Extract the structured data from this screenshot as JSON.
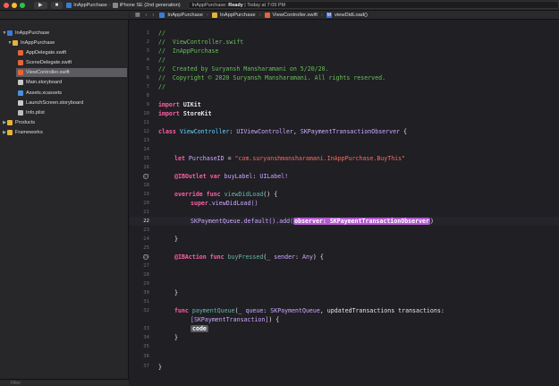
{
  "toolbar": {
    "run_glyph": "▶",
    "stop_glyph": "■",
    "scheme_name": "InAppPurchase",
    "device_name": "iPhone SE (2nd generation)",
    "status_app": "InAppPurchase:",
    "status_state": "Ready",
    "status_time": "Today at 7:09 PM"
  },
  "navigator": {
    "items": [
      {
        "label": "InAppPurchase",
        "icon": "project-icon"
      },
      {
        "label": "InAppPurchase",
        "icon": "folder-icon"
      },
      {
        "label": "AppDelegate.swift",
        "icon": "swift-file-icon"
      },
      {
        "label": "SceneDelegate.swift",
        "icon": "swift-file-icon"
      },
      {
        "label": "ViewController.swift",
        "icon": "swift-file-icon"
      },
      {
        "label": "Main.storyboard",
        "icon": "storyboard-icon"
      },
      {
        "label": "Assets.xcassets",
        "icon": "assets-icon"
      },
      {
        "label": "LaunchScreen.storyboard",
        "icon": "storyboard-icon"
      },
      {
        "label": "Info.plist",
        "icon": "plist-icon"
      },
      {
        "label": "Products",
        "icon": "folder-icon"
      },
      {
        "label": "Frameworks",
        "icon": "folder-icon"
      }
    ],
    "filter_placeholder": "Filter"
  },
  "jumpbar": {
    "crumbs": [
      "InAppPurchase",
      "InAppPurchase",
      "ViewController.swift",
      "viewDidLoad()"
    ],
    "method_badge": "M"
  },
  "editor": {
    "current_line": 22,
    "lines": [
      {
        "n": "1"
      },
      {
        "n": "2"
      },
      {
        "n": "3"
      },
      {
        "n": "4"
      },
      {
        "n": "5"
      },
      {
        "n": "6"
      },
      {
        "n": "7"
      },
      {
        "n": "8"
      },
      {
        "n": "9"
      },
      {
        "n": "10"
      },
      {
        "n": "11"
      },
      {
        "n": "12"
      },
      {
        "n": "13"
      },
      {
        "n": "14"
      },
      {
        "n": "15"
      },
      {
        "n": "16"
      },
      {
        "n": "17"
      },
      {
        "n": "18"
      },
      {
        "n": "19"
      },
      {
        "n": "20"
      },
      {
        "n": "21"
      },
      {
        "n": "22"
      },
      {
        "n": "23"
      },
      {
        "n": "24"
      },
      {
        "n": "25"
      },
      {
        "n": "26"
      },
      {
        "n": "27"
      },
      {
        "n": "28"
      },
      {
        "n": "29"
      },
      {
        "n": "30"
      },
      {
        "n": "31"
      },
      {
        "n": "32"
      },
      {
        "n": "33"
      },
      {
        "n": "34"
      },
      {
        "n": "35"
      },
      {
        "n": "36"
      },
      {
        "n": "37"
      }
    ],
    "code": {
      "c1": "//",
      "c2": "//  ViewController.swift",
      "c3": "//  InAppPurchase",
      "c4": "//",
      "c5": "//  Created by Suryansh Mansharamani on 5/20/20.",
      "c6": "//  Copyright © 2020 Suryansh Mansharamani. All rights reserved.",
      "c7": "//",
      "k_import": "import",
      "uikit": "UIKit",
      "storekit": "StoreKit",
      "k_class": "class",
      "class_name": "ViewController",
      "colon_sp": ": ",
      "uivc": "UIViewController",
      "comma_sp": ", ",
      "observer_proto": "SKPaymentTransactionObserver",
      "brace_open": " {",
      "k_let": "let",
      "prop_name": "PurchaseID",
      "eq": " = ",
      "product_id": "\"com.suryanshmansharamani.InAppPurchase.BuyThis\"",
      "iboutlet": "@IBOutlet",
      "k_var": "var",
      "outlet_name": "buyLabel",
      "uilabel": "UILabel!",
      "k_override": "override",
      "k_func": "func",
      "vdl": "viewDidLoad",
      "parens_brace": "() {",
      "k_super": "super",
      "super_vdl": ".viewDidLoad()",
      "skpq": "SKPaymentQueue",
      "default_add": ".default().add(",
      "observer_placeholder": "observer: SKPaymentTransactionObserver",
      "close_paren": ")",
      "close_brace": "}",
      "ibaction": "@IBAction",
      "buy_pressed": "buyPressed",
      "bp_args_a": "(_ ",
      "bp_sender": "sender",
      "bp_args_b": ": ",
      "any": "Any",
      "bp_args_c": ") {",
      "payment_queue": "paymentQueue",
      "pq_a": "(_ ",
      "pq_queue": "queue",
      "pq_b": ": ",
      "pq_c": ", ",
      "pq_updated": "updatedTransactions transactions",
      "pq_d": ":",
      "sk_tx_array": "[SKPaymentTransaction]",
      "pq_e": ") {",
      "code_placeholder": "code"
    }
  }
}
